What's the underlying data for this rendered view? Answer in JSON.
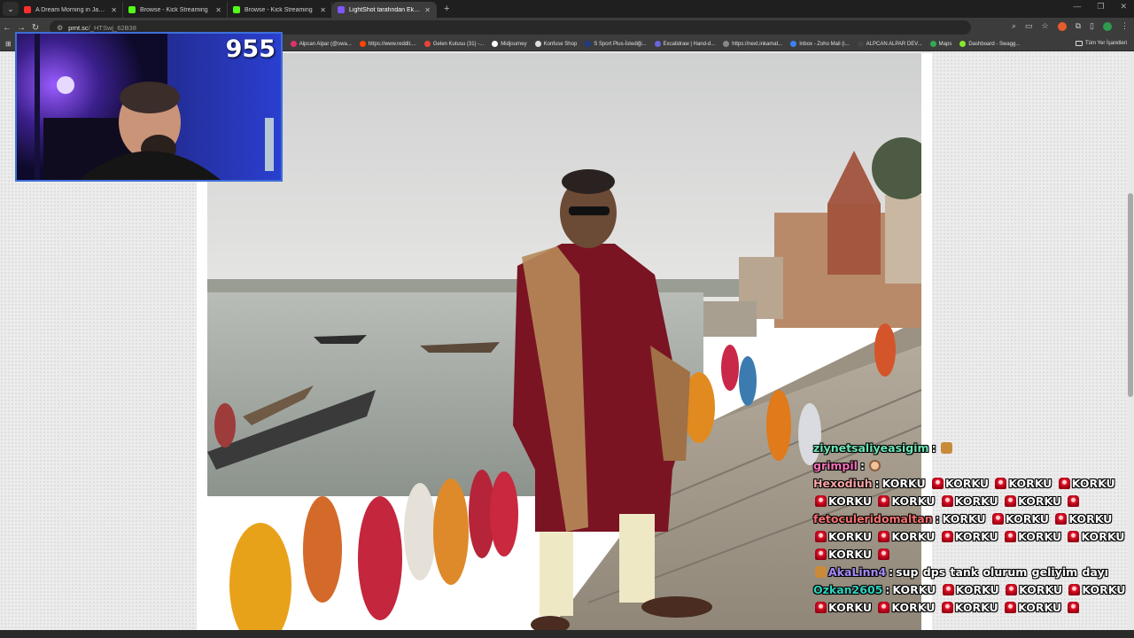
{
  "tabs": [
    {
      "title": "A Dream Morning in Japan",
      "color": "#ff2d2d",
      "active": false
    },
    {
      "title": "Browse - Kick Streaming",
      "color": "#53fc18",
      "active": false
    },
    {
      "title": "Browse - Kick Streaming",
      "color": "#53fc18",
      "active": false
    },
    {
      "title": "LightShot tarafından Ekran Gö",
      "color": "#7e57ff",
      "active": true
    }
  ],
  "address": {
    "host": "prnt.sc",
    "path": "/_HTSwj_62B38"
  },
  "bookmarks": [
    {
      "label": "Alpcan Alpar (@swa...",
      "color": "#e1306c"
    },
    {
      "label": "https://www.reddit....",
      "color": "#ff4500"
    },
    {
      "label": "Gelen Kutusu (31) -...",
      "color": "#ea4335"
    },
    {
      "label": "Midjourney",
      "color": "#ffffff"
    },
    {
      "label": "Konfuse Shop",
      "color": "#dddddd"
    },
    {
      "label": "S Sport Plus-İstediği...",
      "color": "#1e3a8a"
    },
    {
      "label": "Excalidraw | Hand-d...",
      "color": "#6965db"
    },
    {
      "label": "https://next.inkamat...",
      "color": "#888888"
    },
    {
      "label": "Inbox - Zoho Mail (i...",
      "color": "#3b82f6"
    },
    {
      "label": "ALPCAN ALPAR DEV...",
      "color": "#444444"
    },
    {
      "label": "Maps",
      "color": "#34a853"
    },
    {
      "label": "Dashboard - Swagg...",
      "color": "#85ea2d"
    }
  ],
  "bookmarks_all": "Tüm Yer İşaretleri",
  "webcam": {
    "counter": "955"
  },
  "chat": [
    {
      "user": "ziynetsaliyeasigim",
      "color": "#6ee7b7",
      "parts": [
        {
          "emote": "gift"
        }
      ]
    },
    {
      "user": "grimpil",
      "color": "#f472b6",
      "parts": [
        {
          "emote": "face"
        }
      ]
    },
    {
      "user": "Hexodiuh",
      "color": "#fca5a5",
      "parts": [
        {
          "text": "KORKU"
        },
        {
          "emote": "siren"
        },
        {
          "text": "KORKU"
        },
        {
          "emote": "siren"
        },
        {
          "text": "KORKU"
        },
        {
          "emote": "siren"
        },
        {
          "text": "KORKU"
        },
        {
          "emote": "siren"
        },
        {
          "text": "KORKU"
        },
        {
          "emote": "siren"
        },
        {
          "text": "KORKU"
        },
        {
          "emote": "siren"
        },
        {
          "text": "KORKU"
        },
        {
          "emote": "siren"
        },
        {
          "text": "KORKU"
        },
        {
          "emote": "siren"
        }
      ]
    },
    {
      "user": "fetoculeridomaltan",
      "color": "#f87171",
      "parts": [
        {
          "text": "KORKU"
        },
        {
          "emote": "siren"
        },
        {
          "text": "KORKU"
        },
        {
          "emote": "siren"
        },
        {
          "text": "KORKU"
        },
        {
          "emote": "siren"
        },
        {
          "text": "KORKU"
        },
        {
          "emote": "siren"
        },
        {
          "text": "KORKU"
        },
        {
          "emote": "siren"
        },
        {
          "text": "KORKU"
        },
        {
          "emote": "siren"
        },
        {
          "text": "KORKU"
        },
        {
          "emote": "siren"
        },
        {
          "text": "KORKU"
        },
        {
          "emote": "siren"
        },
        {
          "text": "KORKU"
        },
        {
          "emote": "siren"
        }
      ]
    },
    {
      "user": "AkaLinn4",
      "color": "#a78bfa",
      "badge": true,
      "parts": [
        {
          "text": "sup dps tank olurum geliyim dayı"
        }
      ]
    },
    {
      "user": "Ozkan2605",
      "color": "#2dd4bf",
      "parts": [
        {
          "text": "KORKU"
        },
        {
          "emote": "siren"
        },
        {
          "text": "KORKU"
        },
        {
          "emote": "siren"
        },
        {
          "text": "KORKU"
        },
        {
          "emote": "siren"
        },
        {
          "text": "KORKU"
        },
        {
          "emote": "siren"
        },
        {
          "text": "KORKU"
        },
        {
          "emote": "siren"
        },
        {
          "text": "KORKU"
        },
        {
          "emote": "siren"
        },
        {
          "text": "KORKU"
        },
        {
          "emote": "siren"
        },
        {
          "text": "KORKU"
        },
        {
          "emote": "siren"
        }
      ]
    }
  ],
  "colors": {
    "webcam_border": "#3e6fd8",
    "page_bg": "#ececec"
  }
}
